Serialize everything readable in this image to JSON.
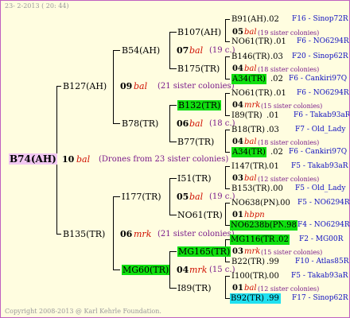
{
  "header": {
    "date": "23- 2-2013 ( 20: 44)",
    "copyright": "Copyright 2008-2013 @ Karl Kehrle Foundation."
  },
  "colors": {
    "green": "#10e010",
    "cyan": "#20e0f0",
    "pink": "#f2c8f2",
    "red": "#d01000",
    "purple": "#7a1a8a",
    "blue": "#1010c0",
    "background": "#fffde0"
  },
  "root": {
    "id": "B74(AH)",
    "num": "10",
    "tag": "bal",
    "note": "(Drones from 23 sister colonies)"
  },
  "gen1": [
    {
      "id": "B127(AH)",
      "num": "09",
      "tag": "bal",
      "note": "(21 sister colonies)"
    },
    {
      "id": "B135(TR)",
      "num": "06",
      "tag": "mrk",
      "note": "(21 sister colonies)"
    }
  ],
  "gen2": [
    {
      "id": "B54(AH)",
      "num": "07",
      "tag": "bal",
      "note": "(19 c.)"
    },
    {
      "id": "B78(TR)",
      "num": "06",
      "tag": "bal",
      "note": "(18 c.)"
    },
    {
      "id": "I177(TR)",
      "num": "05",
      "tag": "bal",
      "note": "(19 c.)"
    },
    {
      "id": "MG60(TR)",
      "num": "04",
      "tag": "mrk",
      "note": "(15 c.)"
    }
  ],
  "gen3": [
    {
      "id": "B107(AH)",
      "num": "05",
      "tag": "bal",
      "note": "(19 sister colonies)"
    },
    {
      "id": "B175(TR)",
      "num": "04",
      "tag": "bal",
      "note": "(18 sister colonies)"
    },
    {
      "id": "B132(TR)",
      "num": "04",
      "tag": "mrk",
      "note": "(15 sister colonies)"
    },
    {
      "id": "B77(TR)",
      "num": "04",
      "tag": "bal",
      "note": "(18 sister colonies)"
    },
    {
      "id": "I51(TR)",
      "num": "03",
      "tag": "bal",
      "note": "(12 sister colonies)"
    },
    {
      "id": "NO61(TR)",
      "num": "01",
      "tag": "hbpn",
      "note": ""
    },
    {
      "id": "MG165(TR)",
      "num": "03",
      "tag": "mrk",
      "note": "(15 sister colonies)"
    },
    {
      "id": "I89(TR)",
      "num": "01",
      "tag": "bal",
      "note": "(12 sister colonies)"
    }
  ],
  "gen4": [
    {
      "id": "B91(AH)",
      "val": ".02",
      "line": "F16 - Sinop72R"
    },
    {
      "id": "NO61(TR)",
      "val": ".01",
      "line": "F6 - NO6294R"
    },
    {
      "id": "B146(TR)",
      "val": ".03",
      "line": "F20 - Sinop62R"
    },
    {
      "id": "A34(TR)",
      "val": ".02",
      "line": "F6 - Cankiri97Q"
    },
    {
      "id": "NO61(TR)",
      "val": ".01",
      "line": "F6 - NO6294R"
    },
    {
      "id": "I89(TR)",
      "val": ".01",
      "line": "F6 - Takab93aR"
    },
    {
      "id": "B18(TR)",
      "val": ".03",
      "line": "F7 - Old_Lady"
    },
    {
      "id": "A34(TR)",
      "val": ".02",
      "line": "F6 - Cankiri97Q"
    },
    {
      "id": "I147(TR)",
      "val": ".01",
      "line": "F5 - Takab93aR"
    },
    {
      "id": "B153(TR)",
      "val": ".00",
      "line": "F5 - Old_Lady"
    },
    {
      "id": "NO638(PN)",
      "val": ".00",
      "line": "F5 - NO6294R"
    },
    {
      "id": "NO6238b(PN)",
      "val": ".98",
      "line": "F4 - NO6294R"
    },
    {
      "id": "MG116(TR)",
      "val": ".02",
      "line": "F2 - MG00R"
    },
    {
      "id": "B22(TR)",
      "val": ".99",
      "line": "F10 - Atlas85R"
    },
    {
      "id": "I100(TR)",
      "val": ".00",
      "line": "F5 - Takab93aR"
    },
    {
      "id": "B92(TR)",
      "val": ".99",
      "line": "F17 - Sinop62R"
    }
  ]
}
